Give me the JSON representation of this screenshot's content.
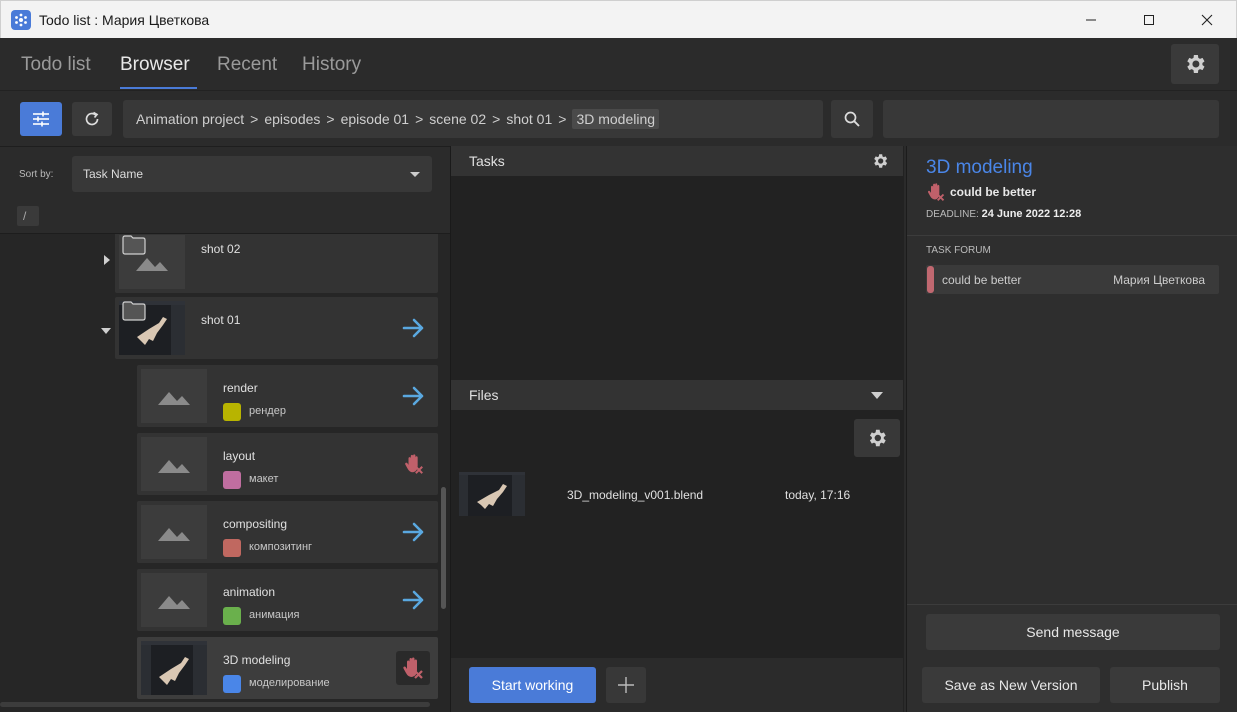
{
  "window": {
    "title": "Todo list : Мария Цветкова"
  },
  "tabs": [
    {
      "label": "Todo list"
    },
    {
      "label": "Browser"
    },
    {
      "label": "Recent"
    },
    {
      "label": "History"
    }
  ],
  "breadcrumb": {
    "items": [
      "Animation project",
      "episodes",
      "episode 01",
      "scene 02",
      "shot 01"
    ],
    "current": "3D modeling",
    "separator": ">"
  },
  "search": {
    "value": "",
    "placeholder": ""
  },
  "sort": {
    "label": "Sort by:",
    "value": "Task Name"
  },
  "path": "/",
  "tree": [
    {
      "title": "shot 02"
    },
    {
      "title": "shot 01"
    },
    {
      "title": "render",
      "status": "рендер",
      "color": "#b8b400"
    },
    {
      "title": "layout",
      "status": "макет",
      "color": "#c06ea0"
    },
    {
      "title": "compositing",
      "status": "композитинг",
      "color": "#c06860"
    },
    {
      "title": "animation",
      "status": "анимация",
      "color": "#6ab04c"
    },
    {
      "title": "3D modeling",
      "status": "моделирование",
      "color": "#4a86e8"
    }
  ],
  "tasks_panel": {
    "header": "Tasks"
  },
  "files_panel": {
    "header": "Files",
    "files": [
      {
        "name": "3D_modeling_v001.blend",
        "date": "today, 17:16"
      }
    ]
  },
  "actions": {
    "start_working": "Start working",
    "send_message": "Send message",
    "save_new_version": "Save as New Version",
    "publish": "Publish"
  },
  "task_detail": {
    "title": "3D modeling",
    "status": "could be better",
    "deadline_label": "DEADLINE:",
    "deadline_value": "24 June 2022 12:28",
    "forum_label": "TASK FORUM",
    "forum_messages": [
      {
        "text": "could be better",
        "author": "Мария Цветкова",
        "color": "#c06870"
      }
    ]
  },
  "colors": {
    "accent": "#4a7bd8",
    "title_blue": "#4a86e8",
    "arrow_blue": "#5aa8e0",
    "reject_red": "#c0606a"
  }
}
